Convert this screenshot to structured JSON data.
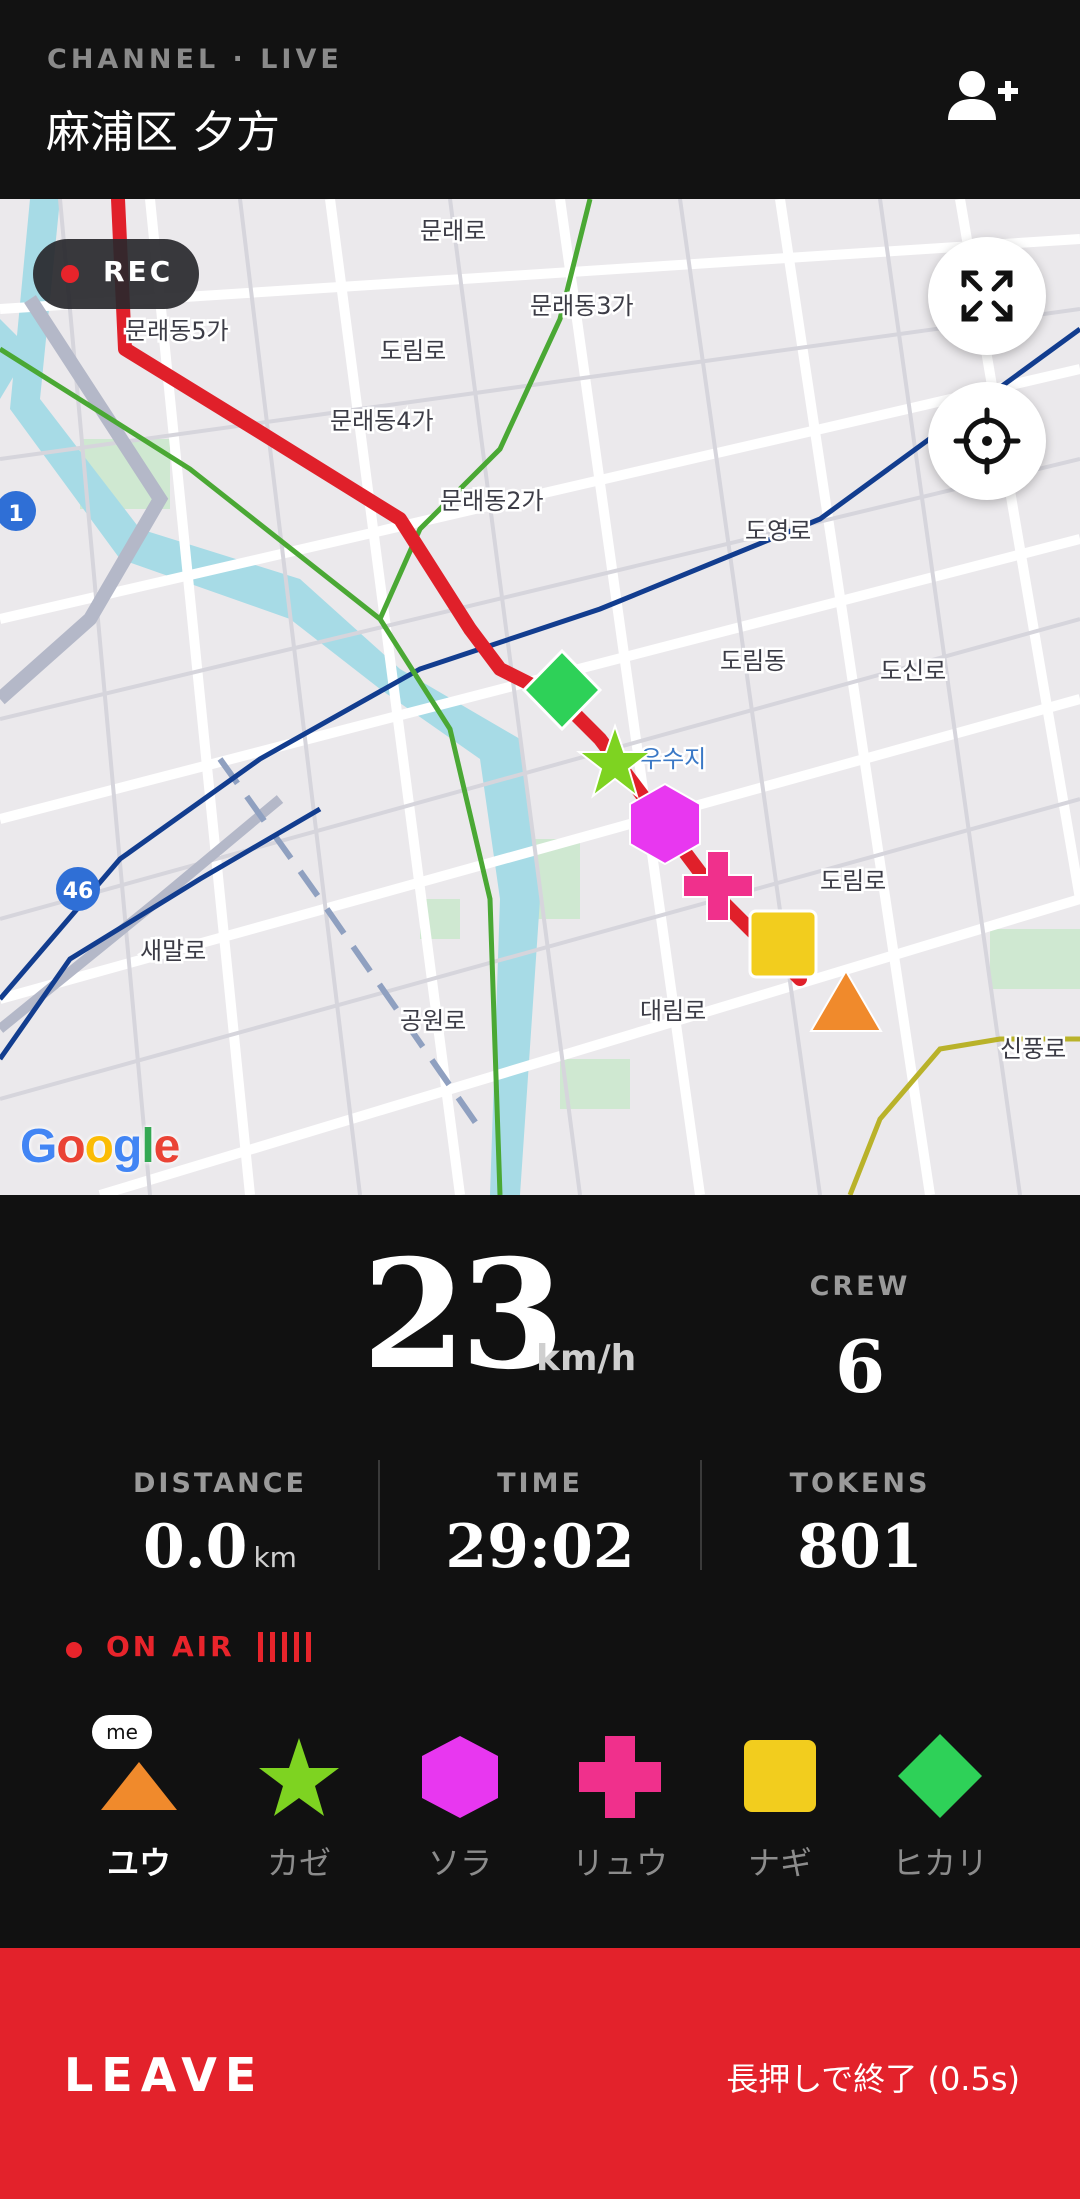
{
  "header": {
    "channel_label": "CHANNEL · LIVE",
    "title": "麻浦区 夕方",
    "add_member_icon": "person-add-icon"
  },
  "map": {
    "rec_label": "REC",
    "fullscreen_icon": "expand-icon",
    "locate_icon": "crosshair-icon",
    "logo": "Google",
    "labels": [
      "문래로",
      "문래동3가",
      "문래동5가",
      "도림로",
      "문래동4가",
      "문래동2가",
      "도영로",
      "도림동",
      "도신로",
      "우수지",
      "도림로",
      "새말로",
      "대림로",
      "공원로",
      "신풍로",
      "46",
      "1"
    ],
    "colors": {
      "route": "#e0202a",
      "subway_blue": "#123d8f",
      "subway_green": "#4aa834",
      "water": "#a7dbe6"
    }
  },
  "stats": {
    "speed": "23",
    "speed_unit": "km/h",
    "crew_label": "CREW",
    "crew_value": "6",
    "distance_label": "DISTANCE",
    "distance_value": "0.0",
    "distance_unit": "km",
    "time_label": "TIME",
    "time_value": "29:02",
    "tokens_label": "TOKENS",
    "tokens_value": "801"
  },
  "onair": {
    "label": "ON AIR"
  },
  "crew": {
    "me_badge": "me",
    "members": [
      {
        "name": "ユウ",
        "shape": "triangle-icon",
        "color": "#f08a2c",
        "is_me": true
      },
      {
        "name": "カゼ",
        "shape": "star-icon",
        "color": "#7ed321",
        "is_me": false
      },
      {
        "name": "ソラ",
        "shape": "hexagon-icon",
        "color": "#e837f0",
        "is_me": false
      },
      {
        "name": "リュウ",
        "shape": "cross-icon",
        "color": "#f0308c",
        "is_me": false
      },
      {
        "name": "ナギ",
        "shape": "square-icon",
        "color": "#f2cd1e",
        "is_me": false
      },
      {
        "name": "ヒカリ",
        "shape": "diamond-icon",
        "color": "#2ed158",
        "is_me": false
      }
    ]
  },
  "leave": {
    "label": "LEAVE",
    "hint": "長押しで終了 (0.5s)"
  }
}
